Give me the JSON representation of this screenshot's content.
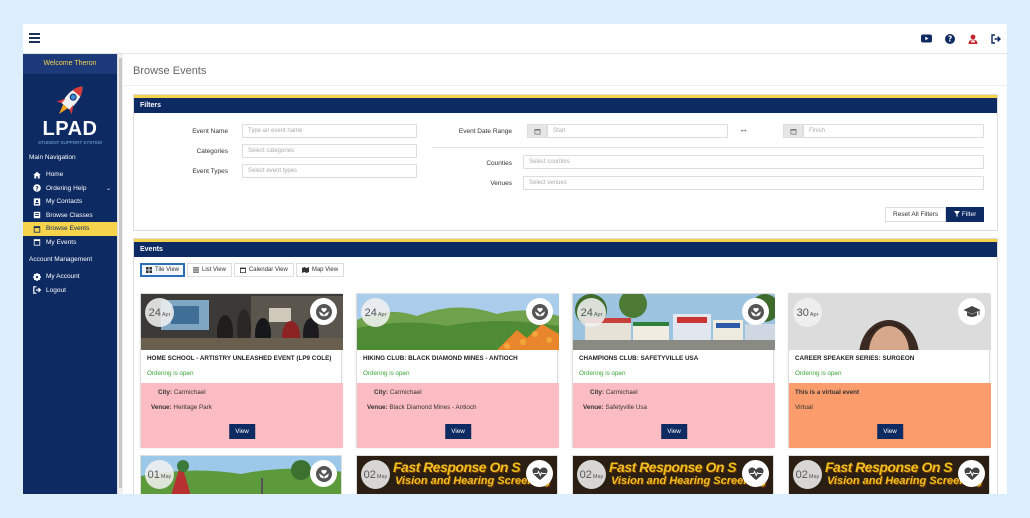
{
  "app": {
    "welcome": "Welcome Theron",
    "logo_text": "LPAD",
    "logo_subtitle": "STUDENT SUPPORT SYSTEM"
  },
  "topbar_icons": [
    "youtube-icon",
    "help-icon",
    "user-icon",
    "logout-icon"
  ],
  "sidebar": {
    "main_heading": "Main Navigation",
    "items": [
      {
        "label": "Home",
        "icon": "home-icon"
      },
      {
        "label": "Ordering Help",
        "icon": "question-icon"
      },
      {
        "label": "My Contacts",
        "icon": "contacts-icon"
      },
      {
        "label": "Browse Classes",
        "icon": "classes-icon"
      },
      {
        "label": "Browse Events",
        "icon": "calendar-icon",
        "active": true
      },
      {
        "label": "My Events",
        "icon": "calendar-icon"
      }
    ],
    "account_heading": "Account Management",
    "account_items": [
      {
        "label": "My Account",
        "icon": "gear-icon"
      },
      {
        "label": "Logout",
        "icon": "logout-icon"
      }
    ]
  },
  "page": {
    "title": "Browse Events"
  },
  "filters": {
    "heading": "Filters",
    "event_name_label": "Event Name",
    "event_name_placeholder": "Type an event name",
    "categories_label": "Categories",
    "categories_placeholder": "Select categories",
    "event_types_label": "Event Types",
    "event_types_placeholder": "Select event types",
    "date_range_label": "Event Date Range",
    "start_placeholder": "Start",
    "range_arrow": "↔",
    "finish_placeholder": "Finish",
    "counties_label": "Counties",
    "counties_placeholder": "Select counties",
    "venues_label": "Venues",
    "venues_placeholder": "Select venues",
    "reset_label": "Reset All Filters",
    "filter_label": "Filter"
  },
  "events": {
    "heading": "Events",
    "views": [
      {
        "label": "Tile View",
        "icon": "grid-icon",
        "active": true
      },
      {
        "label": "List View",
        "icon": "list-icon"
      },
      {
        "label": "Calendar View",
        "icon": "calendar-icon"
      },
      {
        "label": "Map View",
        "icon": "map-icon"
      }
    ],
    "cards": [
      {
        "day": "24",
        "month": "Apr",
        "category_icon": "hands-heart-icon",
        "title": "HOME SCHOOL - ARTISTRY UNLEASHED EVENT (LP9 COLE)",
        "status": "Ordering is open",
        "city_label": "City:",
        "city": "Carmichael",
        "venue_label": "Venue:",
        "venue": "Heritage Park",
        "view_label": "View"
      },
      {
        "day": "24",
        "month": "Apr",
        "category_icon": "hands-heart-icon",
        "title": "HIKING CLUB: BLACK DIAMOND MINES - ANTIOCH",
        "status": "Ordering is open",
        "city_label": "City:",
        "city": "Carmichael",
        "venue_label": "Venue:",
        "venue": "Black Diamond Mines - Antioch",
        "view_label": "View"
      },
      {
        "day": "24",
        "month": "Apr",
        "category_icon": "hands-heart-icon",
        "title": "CHAMPIONS CLUB: SAFETYVILLE USA",
        "status": "Ordering is open",
        "city_label": "City:",
        "city": "Carmichael",
        "venue_label": "Venue:",
        "venue": "Safetyville Usa",
        "view_label": "View"
      },
      {
        "day": "30",
        "month": "Apr",
        "category_icon": "graduation-cap-icon",
        "title": "CAREER SPEAKER SERIES: SURGEON",
        "status": "Ordering is open",
        "virtual_title": "This is a virtual event",
        "virtual_text": "Virtual",
        "view_label": "View"
      }
    ],
    "cards_row2": [
      {
        "day": "01",
        "month": "May",
        "category_icon": "hands-heart-icon"
      },
      {
        "day": "02",
        "month": "May",
        "category_icon": "heart-pulse-icon",
        "banner_line1": "Fast Response On S",
        "banner_line2": "Vision and Hearing Screening"
      },
      {
        "day": "02",
        "month": "May",
        "category_icon": "heart-pulse-icon",
        "banner_line1": "Fast Response On S",
        "banner_line2": "Vision and Hearing Screening"
      },
      {
        "day": "02",
        "month": "May",
        "category_icon": "heart-pulse-icon",
        "banner_line1": "Fast Response On S",
        "banner_line2": "Vision and Hearing Screening"
      }
    ]
  }
}
